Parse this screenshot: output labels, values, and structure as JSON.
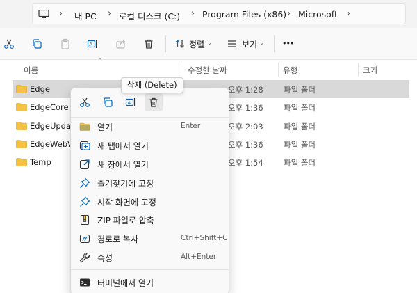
{
  "breadcrumb": {
    "items": [
      "내 PC",
      "로컬 디스크 (C:)",
      "Program Files (x86)",
      "Microsoft"
    ]
  },
  "toolbar": {
    "sort_label": "정렬",
    "view_label": "보기",
    "more_label": "•••"
  },
  "columns": {
    "name": "이름",
    "date": "수정한 날짜",
    "type": "유형",
    "size": "크기"
  },
  "files": [
    {
      "name": "Edge",
      "date": "오후 1:28",
      "type": "파일 폴더"
    },
    {
      "name": "EdgeCore",
      "date": "오후 1:36",
      "type": "파일 폴더"
    },
    {
      "name": "EdgeUpdate",
      "date": "오후 2:03",
      "type": "파일 폴더"
    },
    {
      "name": "EdgeWebView",
      "date": "오후 1:36",
      "type": "파일 폴더"
    },
    {
      "name": "Temp",
      "date": "오후 1:54",
      "type": "파일 폴더"
    }
  ],
  "tooltip": "삭제 (Delete)",
  "context_menu": {
    "items": [
      {
        "label": "열기",
        "shortcut": "Enter",
        "icon": "folder-icon"
      },
      {
        "label": "새 탭에서 열기",
        "shortcut": "",
        "icon": "new-tab-icon"
      },
      {
        "label": "새 창에서 열기",
        "shortcut": "",
        "icon": "new-window-icon"
      },
      {
        "label": "즐겨찾기에 고정",
        "shortcut": "",
        "icon": "pin-icon"
      },
      {
        "label": "시작 화면에 고정",
        "shortcut": "",
        "icon": "pin-icon"
      },
      {
        "label": "ZIP 파일로 압축",
        "shortcut": "",
        "icon": "zip-icon"
      },
      {
        "label": "경로로 복사",
        "shortcut": "Ctrl+Shift+C",
        "icon": "copy-path-icon"
      },
      {
        "label": "속성",
        "shortcut": "Alt+Enter",
        "icon": "wrench-icon"
      },
      {
        "label": "터미널에서 열기",
        "shortcut": "",
        "icon": "terminal-icon"
      }
    ]
  },
  "colors": {
    "accent": "#0067c0",
    "folder": "#f5c242",
    "selected_row": "#d9d9d9"
  }
}
